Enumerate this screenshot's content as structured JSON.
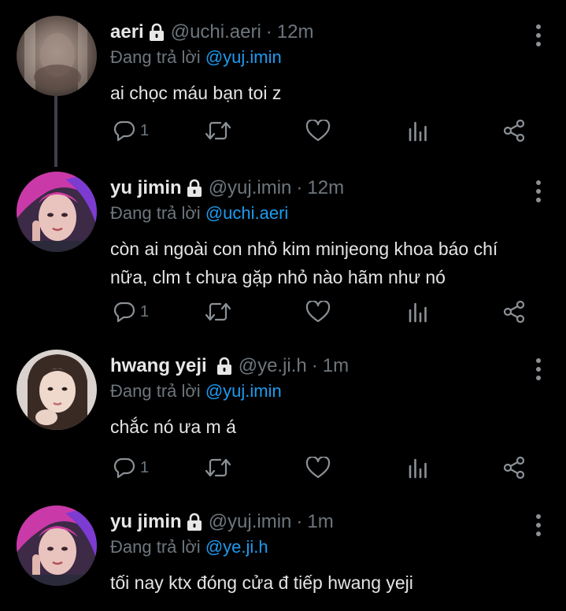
{
  "tweets": [
    {
      "display_name": "aeri",
      "handle": "@uchi.aeri",
      "separator": "·",
      "time": "12m",
      "reply_prefix": "Đang trả lời",
      "reply_to": "@yuj.imin",
      "text": "ai chọc máu bạn toi z",
      "reply_count": "1",
      "avatar_icon": "avatar-blurred-photo"
    },
    {
      "display_name": "yu jimin",
      "handle": "@yuj.imin",
      "separator": "·",
      "time": "12m",
      "reply_prefix": "Đang trả lời",
      "reply_to": "@uchi.aeri",
      "text": "còn ai ngoài con nhỏ kim minjeong khoa báo chí nữa, clm t chưa gặp nhỏ nào hãm như nó",
      "reply_count": "1",
      "avatar_icon": "avatar-pink-hair-photo"
    },
    {
      "display_name": "hwang yeji",
      "handle": "@ye.ji.h",
      "separator": "·",
      "time": "1m",
      "reply_prefix": "Đang trả lời",
      "reply_to": "@yuj.imin",
      "text": "chắc nó ưa m á",
      "reply_count": "1",
      "avatar_icon": "avatar-dark-hair-photo"
    },
    {
      "display_name": "yu jimin",
      "handle": "@yuj.imin",
      "separator": "·",
      "time": "1m",
      "reply_prefix": "Đang trả lời",
      "reply_to": "@ye.ji.h",
      "text": "tối nay ktx đóng cửa đ tiếp hwang yeji",
      "reply_count": "",
      "avatar_icon": "avatar-pink-hair-photo"
    }
  ],
  "icons": {
    "lock": "lock-icon",
    "more": "more-vertical-icon",
    "reply": "reply-icon",
    "retweet": "retweet-icon",
    "like": "heart-icon",
    "analytics": "analytics-icon",
    "share": "share-icon"
  },
  "colors": {
    "background": "#000000",
    "mention": "#1d9bf0",
    "muted": "#6e767d",
    "thread_line": "#3d4145"
  }
}
